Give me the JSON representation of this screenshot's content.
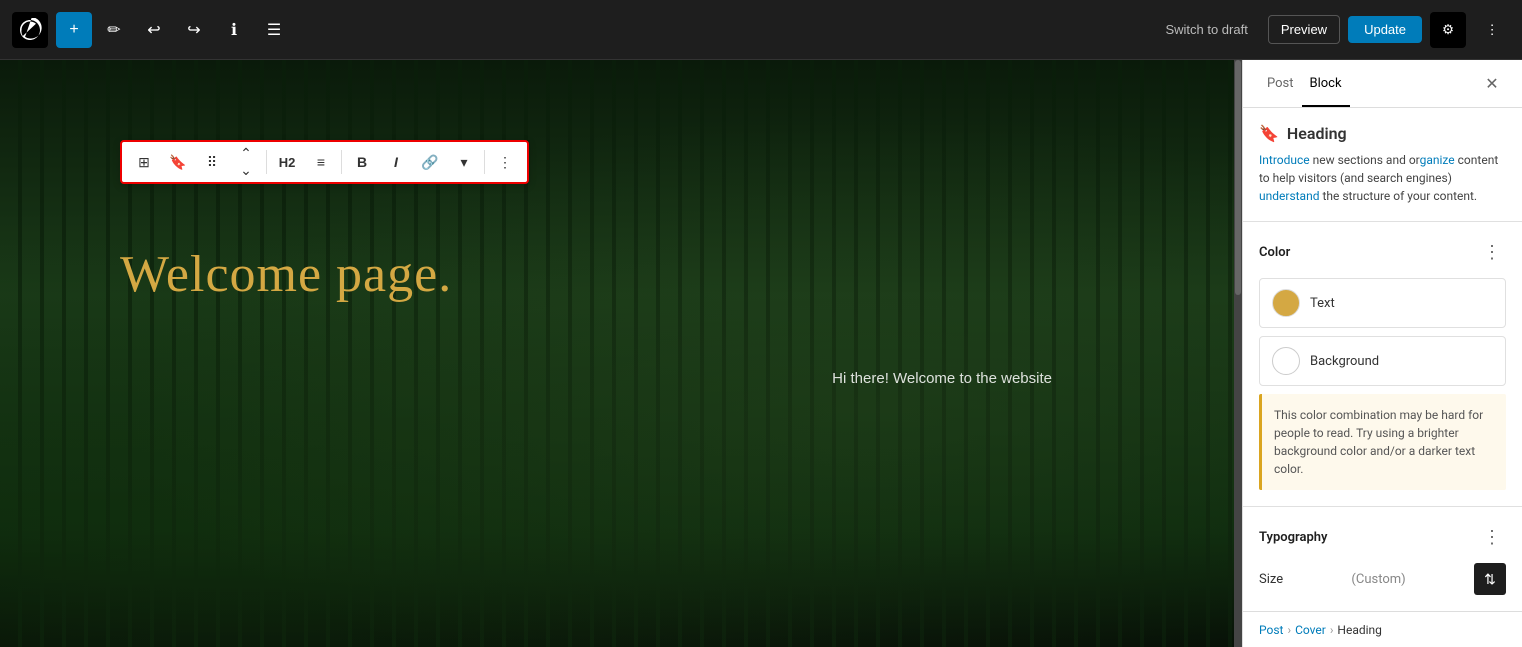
{
  "topbar": {
    "add_label": "+",
    "switch_draft_label": "Switch to draft",
    "preview_label": "Preview",
    "update_label": "Update"
  },
  "panel": {
    "post_tab": "Post",
    "block_tab": "Block",
    "block_title": "Heading",
    "block_desc_part1": "Introduce new sections and or",
    "block_desc_part2": "ganize content to help visitors (and search engines) understand the structure of your content.",
    "color_section_title": "Color",
    "text_label": "Text",
    "background_label": "Background",
    "warning_text": "This color combination may be hard for people to read. Try using a brighter background color and/or a darker text color.",
    "typography_section_title": "Typography",
    "size_label": "Size",
    "size_custom": "(Custom)"
  },
  "editor": {
    "heading_text": "Welcome page.",
    "sub_text": "Hi there! Welcome to the website"
  },
  "breadcrumb": {
    "post": "Post",
    "cover": "Cover",
    "heading": "Heading"
  },
  "toolbar": {
    "h2": "H2"
  },
  "colors": {
    "text_color": "#d4a843",
    "background_color": "#ffffff"
  }
}
